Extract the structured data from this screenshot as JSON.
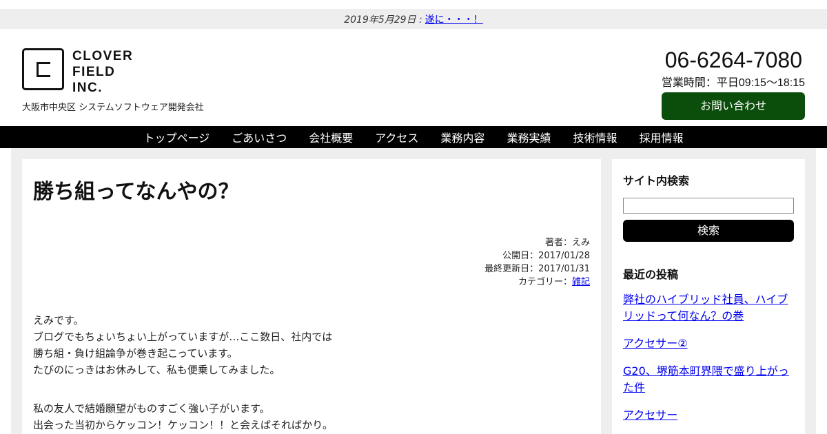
{
  "topbar": {
    "date": "2019年5月29日 :",
    "news_link": "遂に・・・！"
  },
  "header": {
    "logo_lines": [
      "CLOVER",
      "FIELD",
      "INC."
    ],
    "tagline": "大阪市中央区 システムソフトウェア開発会社",
    "phone": "06-6264-7080",
    "hours": "営業時間：平日09:15〜18:15",
    "contact_button": "お問い合わせ"
  },
  "nav": {
    "items": [
      "トップページ",
      "ごあいさつ",
      "会社概要",
      "アクセス",
      "業務内容",
      "業務実績",
      "技術情報",
      "採用情報"
    ]
  },
  "post": {
    "title": "勝ち組ってなんやの？",
    "author": "著者：えみ",
    "published": "公開日：2017/01/28",
    "updated": "最終更新日：2017/01/31",
    "category_label": "カテゴリー：",
    "category": "雑記",
    "paragraphs": [
      [
        "えみです。",
        "ブログでもちょいちょい上がっていますが…ここ数日、社内では",
        "勝ち組・負け組論争が巻き起こっています。",
        "たびのにっきはお休みして、私も便乗してみました。"
      ],
      [
        "私の友人で結婚願望がものすごく強い子がいます。",
        "出会った当初からケッコン！ケッコン！！と会えばそればかり。"
      ]
    ]
  },
  "sidebar": {
    "search_title": "サイト内検索",
    "search_value": "",
    "search_button": "検索",
    "recent_title": "最近の投稿",
    "recent_posts": [
      "弊社のハイブリッド社員、ハイブリッドって何なん？の巻",
      "アクセサー②",
      "G20、堺筋本町界隈で盛り上がった件",
      "アクセサー"
    ]
  }
}
